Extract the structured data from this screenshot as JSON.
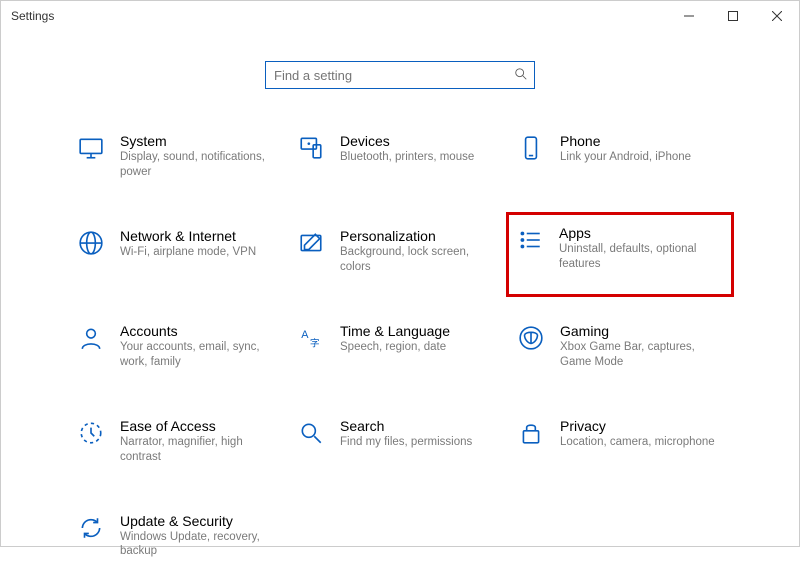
{
  "window": {
    "title": "Settings"
  },
  "search": {
    "placeholder": "Find a setting"
  },
  "tiles": {
    "system": {
      "title": "System",
      "desc": "Display, sound, notifications, power"
    },
    "devices": {
      "title": "Devices",
      "desc": "Bluetooth, printers, mouse"
    },
    "phone": {
      "title": "Phone",
      "desc": "Link your Android, iPhone"
    },
    "network": {
      "title": "Network & Internet",
      "desc": "Wi-Fi, airplane mode, VPN"
    },
    "personalization": {
      "title": "Personalization",
      "desc": "Background, lock screen, colors"
    },
    "apps": {
      "title": "Apps",
      "desc": "Uninstall, defaults, optional features"
    },
    "accounts": {
      "title": "Accounts",
      "desc": "Your accounts, email, sync, work, family"
    },
    "time": {
      "title": "Time & Language",
      "desc": "Speech, region, date"
    },
    "gaming": {
      "title": "Gaming",
      "desc": "Xbox Game Bar, captures, Game Mode"
    },
    "ease": {
      "title": "Ease of Access",
      "desc": "Narrator, magnifier, high contrast"
    },
    "search_cat": {
      "title": "Search",
      "desc": "Find my files, permissions"
    },
    "privacy": {
      "title": "Privacy",
      "desc": "Location, camera, microphone"
    },
    "update": {
      "title": "Update & Security",
      "desc": "Windows Update, recovery, backup"
    }
  }
}
